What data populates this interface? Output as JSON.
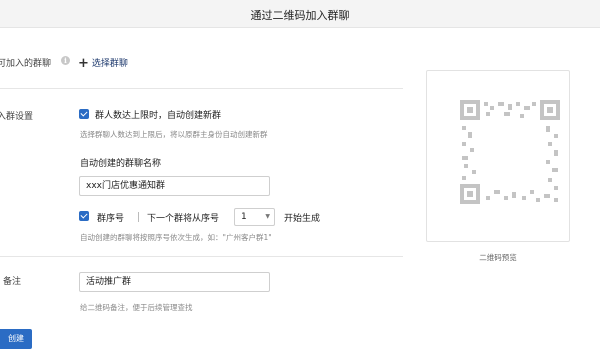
{
  "header": {
    "title": "通过二维码加入群聊"
  },
  "group_section": {
    "label": "可加入的群聊",
    "info_icon": "i",
    "select_label": "选择群聊"
  },
  "settings": {
    "label": "入群设置",
    "auto_create": {
      "checked": true,
      "label": "群人数达上限时，自动创建新群",
      "hint": "选择群聊人数达到上限后，将以原群主身份自动创建新群"
    },
    "name_field": {
      "label": "自动创建的群聊名称",
      "value": "xxx门店优惠通知群"
    },
    "serial": {
      "checked": true,
      "label": "群序号",
      "next_label": "下一个群将从序号",
      "start_value": "1",
      "suffix": "开始生成",
      "hint": "自动创建的群聊将按照序号依次生成，如：\"广州客户群1\""
    }
  },
  "remark": {
    "label": "备注",
    "value": "活动推广群",
    "hint": "给二维码备注，便于后续管理查找"
  },
  "create_button": "创建",
  "preview": {
    "label": "二维码预览"
  },
  "colors": {
    "accent": "#2b6cc4",
    "header_bg": "#f4f4f4",
    "qr_gray": "#c4c4c4"
  }
}
